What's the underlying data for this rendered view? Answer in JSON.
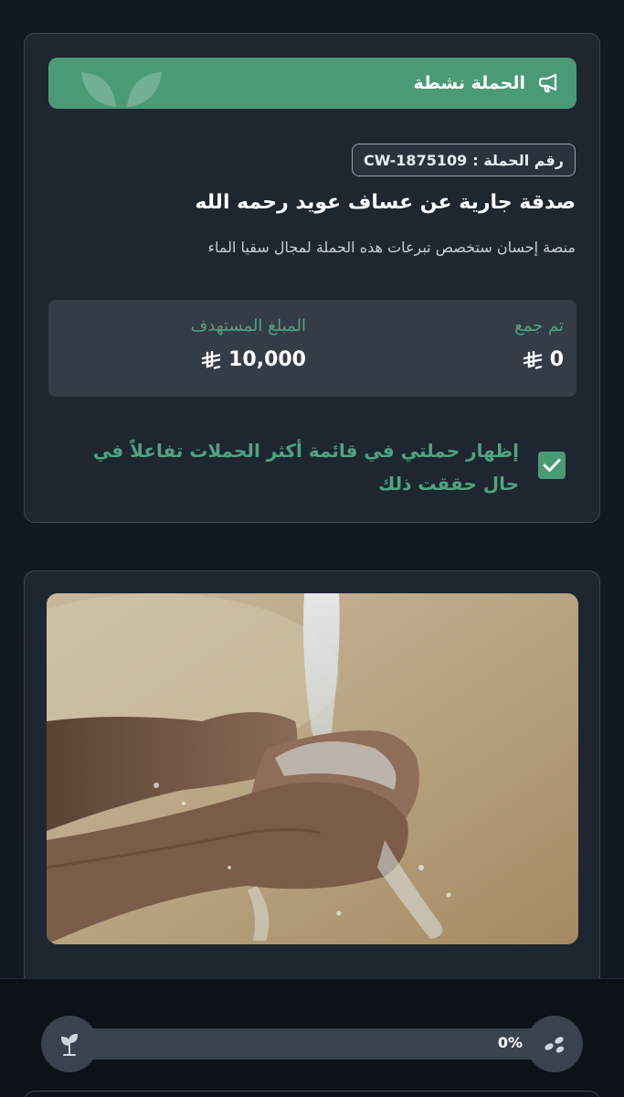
{
  "status": {
    "label": "الحملة نشطة",
    "icon": "megaphone-icon",
    "decor": "leaves"
  },
  "campaign": {
    "id_label": "رقم الحملة :",
    "id_value": "CW-1875109",
    "title": "صدقة جارية عن عساف عويد رحمه الله",
    "description": "منصة إحسان ستخصص تبرعات هذه الحملة لمجال سقيا الماء"
  },
  "stats": {
    "collected_label": "تم جمع",
    "collected_value": "0",
    "target_label": "المبلغ المستهدف",
    "target_value": "10,000",
    "currency_icon": "riyal-icon"
  },
  "option": {
    "checked": true,
    "label": "إظهار حملتي في قائمة أكثر الحملات تفاعلاً في حال حققت ذلك"
  },
  "image": {
    "subject": "hands-water-photo"
  },
  "progress": {
    "percent_label": "0%",
    "fraction": 0,
    "left_icon": "sprout-icon",
    "right_icon": "seeds-icon"
  },
  "colors": {
    "accent": "#4a9a76",
    "accent_text": "#4fa47e",
    "background": "#111822",
    "card": "#1e2630"
  }
}
